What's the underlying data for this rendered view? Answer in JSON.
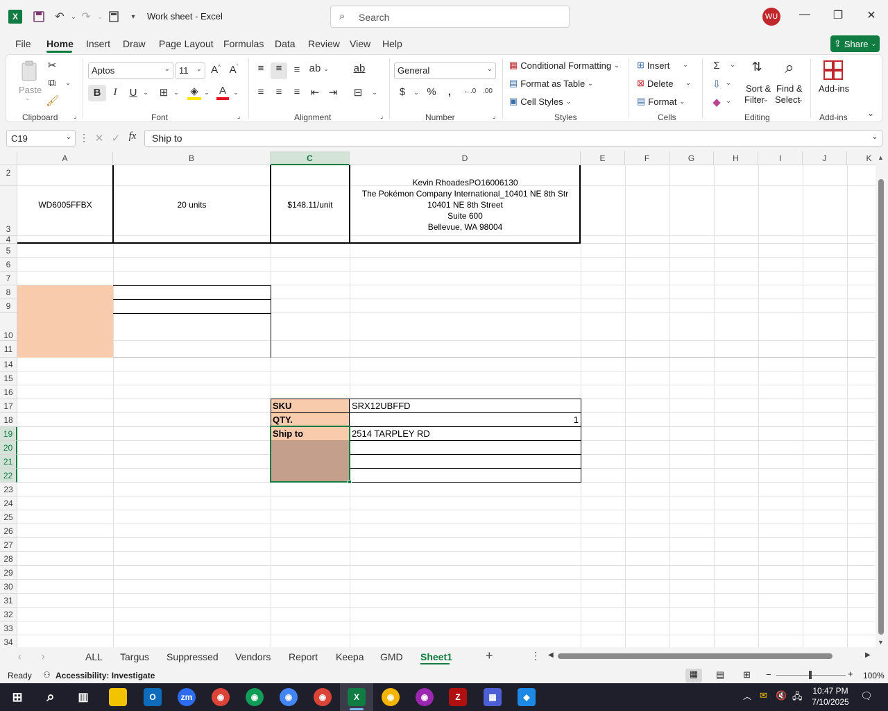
{
  "titlebar": {
    "doc_title": "Work sheet  -  Excel",
    "search_placeholder": "Search",
    "avatar_initials": "WU"
  },
  "menu": [
    "File",
    "Home",
    "Insert",
    "Draw",
    "Page Layout",
    "Formulas",
    "Data",
    "Review",
    "View",
    "Help"
  ],
  "share_label": "Share",
  "ribbon": {
    "clipboard": {
      "paste": "Paste",
      "label": "Clipboard"
    },
    "font": {
      "name": "Aptos",
      "size": "11",
      "label": "Font"
    },
    "alignment": {
      "label": "Alignment"
    },
    "number": {
      "format": "General",
      "label": "Number"
    },
    "styles": {
      "conditional": "Conditional Formatting",
      "format_table": "Format as Table",
      "cell_styles": "Cell Styles",
      "label": "Styles"
    },
    "cells": {
      "insert": "Insert",
      "delete": "Delete",
      "format": "Format",
      "label": "Cells"
    },
    "editing": {
      "sort1": "Sort &",
      "sort2": "Filter",
      "find1": "Find &",
      "find2": "Select",
      "label": "Editing"
    },
    "addins": {
      "button": "Add-ins",
      "label": "Add-ins"
    }
  },
  "formula_bar": {
    "name_box": "C19",
    "fx": "fx",
    "content": "Ship to"
  },
  "columns": [
    "A",
    "B",
    "C",
    "D",
    "E",
    "F",
    "G",
    "H",
    "I",
    "J",
    "K"
  ],
  "rows": [
    "2",
    "3",
    "4",
    "5",
    "6",
    "7",
    "8",
    "9",
    "10",
    "11",
    "14",
    "15",
    "16",
    "17",
    "18",
    "19",
    "20",
    "21",
    "22",
    "23",
    "24",
    "25",
    "26",
    "27",
    "28",
    "29",
    "30",
    "31",
    "32",
    "33",
    "34"
  ],
  "cells": {
    "a2": "WD6005FFBX",
    "b2": "20 units",
    "c2": "$148.11/unit",
    "d2_lines": [
      "Kevin RhoadesPO16006130",
      "The Pokémon Company International_10401 NE 8th Str",
      "10401 NE 8th Street",
      "Suite 600",
      "Bellevue, WA 98004"
    ],
    "c17": "SKU",
    "d17": "SRX12UBFFD",
    "c18": "QTY.",
    "d18": "1",
    "c19": "Ship to",
    "d19": "2514 TARPLEY RD"
  },
  "sheets": [
    "ALL",
    "Targus",
    "Suppressed",
    "Vendors",
    "Report",
    "Keepa",
    "GMD",
    "Sheet1"
  ],
  "status": {
    "ready": "Ready",
    "accessibility": "Accessibility: Investigate",
    "zoom": "100%"
  },
  "clock": {
    "time": "10:47 PM",
    "date": "7/10/2025"
  }
}
